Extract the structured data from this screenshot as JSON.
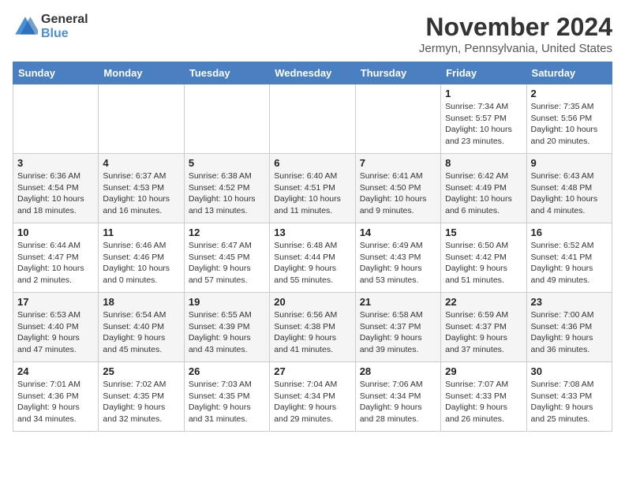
{
  "logo": {
    "general": "General",
    "blue": "Blue"
  },
  "title": "November 2024",
  "location": "Jermyn, Pennsylvania, United States",
  "weekdays": [
    "Sunday",
    "Monday",
    "Tuesday",
    "Wednesday",
    "Thursday",
    "Friday",
    "Saturday"
  ],
  "weeks": [
    [
      {
        "day": "",
        "info": ""
      },
      {
        "day": "",
        "info": ""
      },
      {
        "day": "",
        "info": ""
      },
      {
        "day": "",
        "info": ""
      },
      {
        "day": "",
        "info": ""
      },
      {
        "day": "1",
        "info": "Sunrise: 7:34 AM\nSunset: 5:57 PM\nDaylight: 10 hours and 23 minutes."
      },
      {
        "day": "2",
        "info": "Sunrise: 7:35 AM\nSunset: 5:56 PM\nDaylight: 10 hours and 20 minutes."
      }
    ],
    [
      {
        "day": "3",
        "info": "Sunrise: 6:36 AM\nSunset: 4:54 PM\nDaylight: 10 hours and 18 minutes."
      },
      {
        "day": "4",
        "info": "Sunrise: 6:37 AM\nSunset: 4:53 PM\nDaylight: 10 hours and 16 minutes."
      },
      {
        "day": "5",
        "info": "Sunrise: 6:38 AM\nSunset: 4:52 PM\nDaylight: 10 hours and 13 minutes."
      },
      {
        "day": "6",
        "info": "Sunrise: 6:40 AM\nSunset: 4:51 PM\nDaylight: 10 hours and 11 minutes."
      },
      {
        "day": "7",
        "info": "Sunrise: 6:41 AM\nSunset: 4:50 PM\nDaylight: 10 hours and 9 minutes."
      },
      {
        "day": "8",
        "info": "Sunrise: 6:42 AM\nSunset: 4:49 PM\nDaylight: 10 hours and 6 minutes."
      },
      {
        "day": "9",
        "info": "Sunrise: 6:43 AM\nSunset: 4:48 PM\nDaylight: 10 hours and 4 minutes."
      }
    ],
    [
      {
        "day": "10",
        "info": "Sunrise: 6:44 AM\nSunset: 4:47 PM\nDaylight: 10 hours and 2 minutes."
      },
      {
        "day": "11",
        "info": "Sunrise: 6:46 AM\nSunset: 4:46 PM\nDaylight: 10 hours and 0 minutes."
      },
      {
        "day": "12",
        "info": "Sunrise: 6:47 AM\nSunset: 4:45 PM\nDaylight: 9 hours and 57 minutes."
      },
      {
        "day": "13",
        "info": "Sunrise: 6:48 AM\nSunset: 4:44 PM\nDaylight: 9 hours and 55 minutes."
      },
      {
        "day": "14",
        "info": "Sunrise: 6:49 AM\nSunset: 4:43 PM\nDaylight: 9 hours and 53 minutes."
      },
      {
        "day": "15",
        "info": "Sunrise: 6:50 AM\nSunset: 4:42 PM\nDaylight: 9 hours and 51 minutes."
      },
      {
        "day": "16",
        "info": "Sunrise: 6:52 AM\nSunset: 4:41 PM\nDaylight: 9 hours and 49 minutes."
      }
    ],
    [
      {
        "day": "17",
        "info": "Sunrise: 6:53 AM\nSunset: 4:40 PM\nDaylight: 9 hours and 47 minutes."
      },
      {
        "day": "18",
        "info": "Sunrise: 6:54 AM\nSunset: 4:40 PM\nDaylight: 9 hours and 45 minutes."
      },
      {
        "day": "19",
        "info": "Sunrise: 6:55 AM\nSunset: 4:39 PM\nDaylight: 9 hours and 43 minutes."
      },
      {
        "day": "20",
        "info": "Sunrise: 6:56 AM\nSunset: 4:38 PM\nDaylight: 9 hours and 41 minutes."
      },
      {
        "day": "21",
        "info": "Sunrise: 6:58 AM\nSunset: 4:37 PM\nDaylight: 9 hours and 39 minutes."
      },
      {
        "day": "22",
        "info": "Sunrise: 6:59 AM\nSunset: 4:37 PM\nDaylight: 9 hours and 37 minutes."
      },
      {
        "day": "23",
        "info": "Sunrise: 7:00 AM\nSunset: 4:36 PM\nDaylight: 9 hours and 36 minutes."
      }
    ],
    [
      {
        "day": "24",
        "info": "Sunrise: 7:01 AM\nSunset: 4:36 PM\nDaylight: 9 hours and 34 minutes."
      },
      {
        "day": "25",
        "info": "Sunrise: 7:02 AM\nSunset: 4:35 PM\nDaylight: 9 hours and 32 minutes."
      },
      {
        "day": "26",
        "info": "Sunrise: 7:03 AM\nSunset: 4:35 PM\nDaylight: 9 hours and 31 minutes."
      },
      {
        "day": "27",
        "info": "Sunrise: 7:04 AM\nSunset: 4:34 PM\nDaylight: 9 hours and 29 minutes."
      },
      {
        "day": "28",
        "info": "Sunrise: 7:06 AM\nSunset: 4:34 PM\nDaylight: 9 hours and 28 minutes."
      },
      {
        "day": "29",
        "info": "Sunrise: 7:07 AM\nSunset: 4:33 PM\nDaylight: 9 hours and 26 minutes."
      },
      {
        "day": "30",
        "info": "Sunrise: 7:08 AM\nSunset: 4:33 PM\nDaylight: 9 hours and 25 minutes."
      }
    ]
  ]
}
